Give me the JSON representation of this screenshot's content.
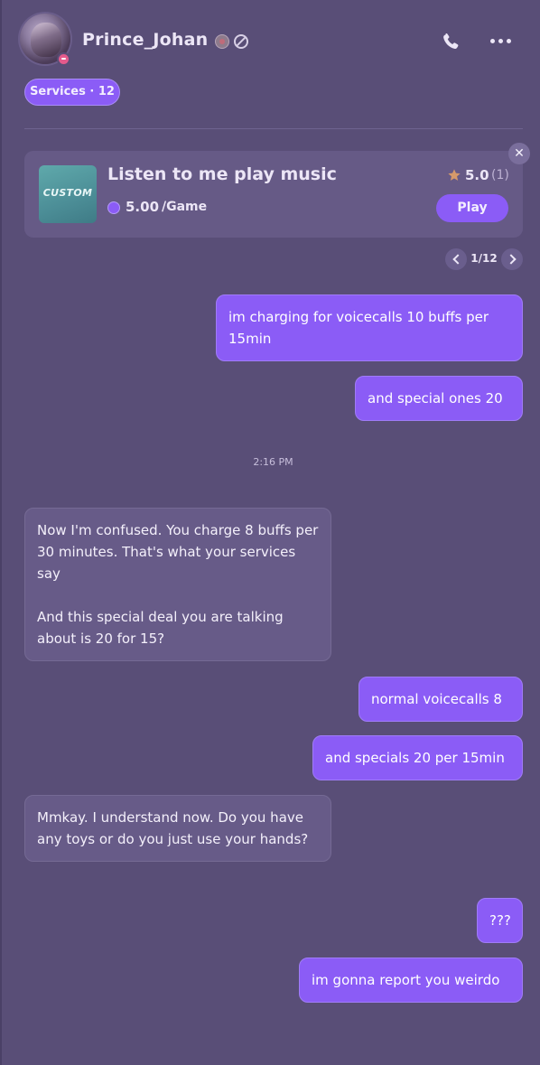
{
  "header": {
    "username": "Prince_Johan",
    "services_pill": "Services · 12"
  },
  "service_card": {
    "thumb_text": "CUSTOM",
    "title": "Listen to me play music",
    "price": "5.00",
    "unit": "/Game",
    "rating": "5.0",
    "rating_count": "(1)",
    "play_label": "Play",
    "close_label": "✕",
    "pager": "1/12"
  },
  "messages": [
    {
      "dir": "out",
      "text": "im charging for voicecalls 10 buffs per 15min"
    },
    {
      "dir": "out",
      "text": "and special ones 20"
    },
    {
      "dir": "in",
      "text": "Now I'm confused. You charge 8 buffs per 30 minutes. That's what your services say\n\nAnd this special deal you are talking about is 20 for 15?"
    },
    {
      "dir": "out",
      "text": "normal voicecalls 8"
    },
    {
      "dir": "out",
      "text": "and specials 20 per 15min"
    },
    {
      "dir": "in",
      "text": "Mmkay. I understand now. Do you have any toys or do you just use your hands?"
    },
    {
      "dir": "out",
      "text": "???"
    },
    {
      "dir": "out",
      "text": "im gonna report you weirdo"
    }
  ],
  "timestamp": "2:16 PM",
  "colors": {
    "background": "#594e77",
    "accent": "#8b5cf6",
    "incoming_bubble": "#675b88",
    "card": "#665a86"
  },
  "icons": [
    "phone-icon",
    "more-icon",
    "star-icon",
    "coin-icon",
    "block-icon",
    "badge-icon"
  ]
}
